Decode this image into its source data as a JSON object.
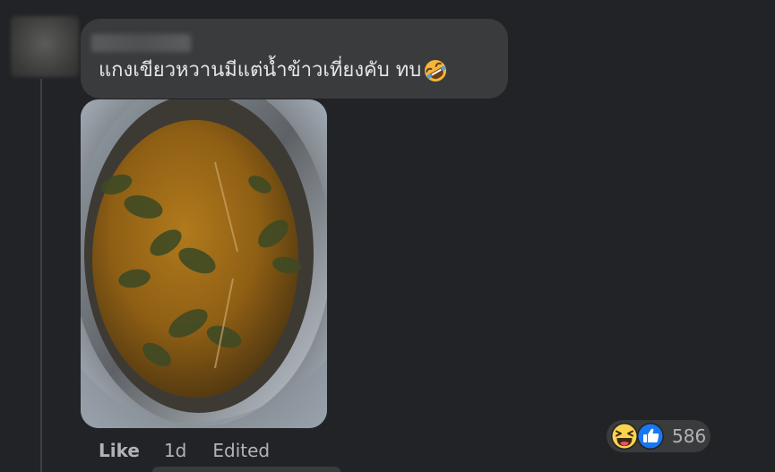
{
  "comment": {
    "text": "แกงเขียวหวานมีแต่น้ำข้าวเที่ยงคับ ทบ",
    "inline_emoji": "rolling-on-floor-laughing-emoji",
    "photo_subject": "green-curry-in-pot"
  },
  "actions": {
    "like_label": "Like",
    "time_label": "1d",
    "edited_label": "Edited"
  },
  "reactions": {
    "icons": [
      "haha-reaction-icon",
      "like-reaction-icon"
    ],
    "count": "586"
  },
  "colors": {
    "background": "#222326",
    "bubble": "#3a3b3c",
    "primary_text": "#e4e6eb",
    "secondary_text": "#b0b3b8",
    "like_blue": "#1877f2",
    "haha_yellow": "#fcd34d"
  }
}
